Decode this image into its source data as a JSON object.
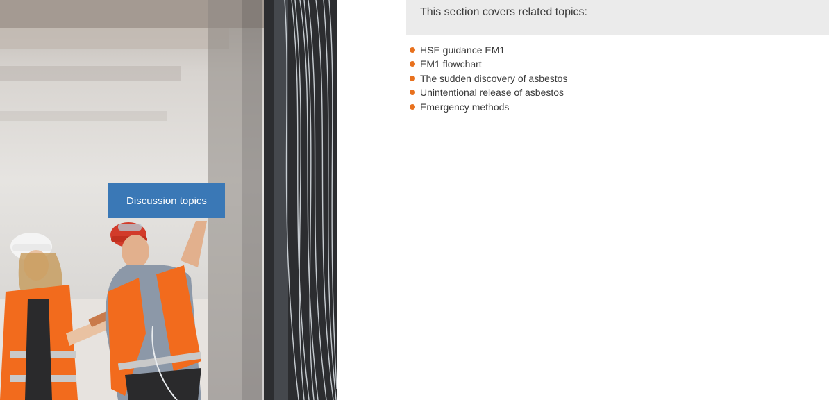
{
  "hero": {
    "image_description": "",
    "button_label": "Discussion topics"
  },
  "related": {
    "heading": "This section covers related topics:",
    "items": [
      {
        "label": "HSE guidance EM1"
      },
      {
        "label": "EM1 flowchart"
      },
      {
        "label": "The sudden discovery of asbestos"
      },
      {
        "label": "Unintentional release of asbestos"
      },
      {
        "label": "Emergency methods"
      }
    ]
  },
  "colors": {
    "button_bg": "#3a78b6",
    "banner_bg": "#ebebeb",
    "bullet": "#e8711e",
    "hi_vis": "#f26b1d"
  }
}
